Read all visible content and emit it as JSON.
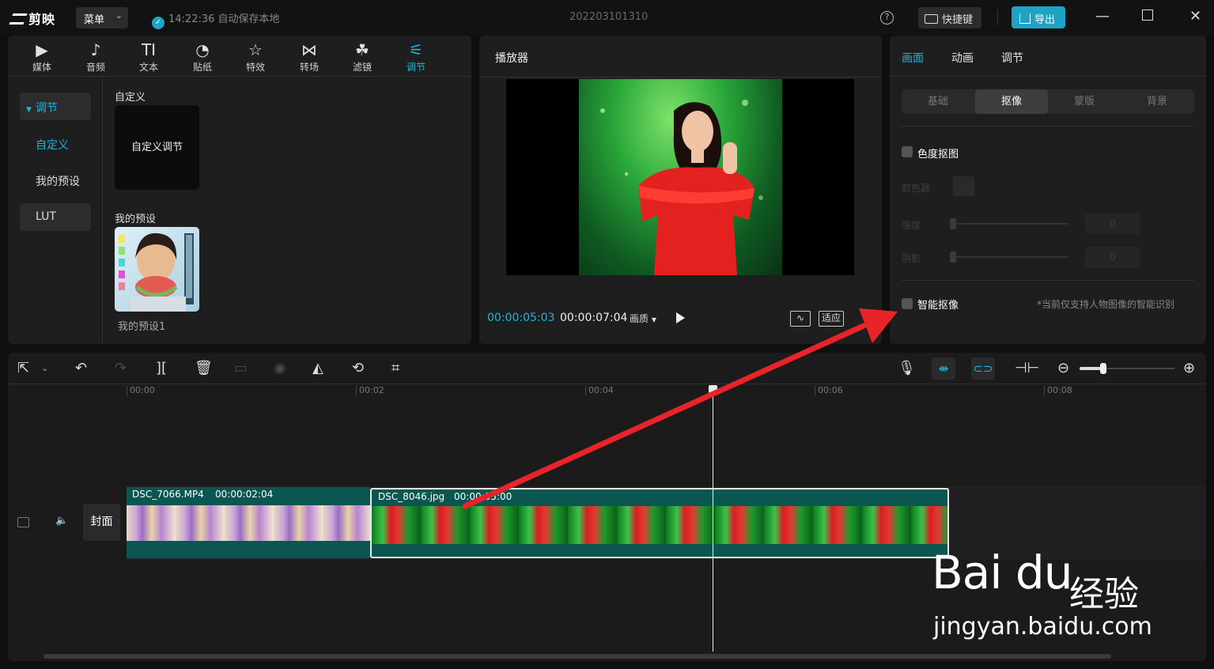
{
  "app": {
    "logo": "剪映",
    "menu": "菜单",
    "save_status": "14:22:36 自动保存本地",
    "project_title": "202203101310",
    "help": "?",
    "shortcut": "快捷键",
    "export": "导出"
  },
  "left_panel": {
    "tools": [
      {
        "label": "媒体",
        "icon": "media-icon"
      },
      {
        "label": "音频",
        "icon": "audio-icon"
      },
      {
        "label": "文本",
        "icon": "text-icon",
        "glyph": "TI"
      },
      {
        "label": "贴纸",
        "icon": "sticker-icon"
      },
      {
        "label": "特效",
        "icon": "effects-icon"
      },
      {
        "label": "转场",
        "icon": "transition-icon"
      },
      {
        "label": "滤镜",
        "icon": "filter-icon"
      },
      {
        "label": "调节",
        "icon": "adjust-icon"
      }
    ],
    "active_tool": "调节",
    "side": {
      "header": "调节",
      "items": [
        "自定义",
        "我的预设",
        "LUT"
      ]
    },
    "custom_section": "自定义",
    "custom_card": "自定义调节",
    "preset_section": "我的预设",
    "preset_name": "我的预设1"
  },
  "player": {
    "title": "播放器",
    "current_time": "00:00:05:03",
    "total_time": "00:00:07:04",
    "quality": "画质",
    "fit": "适应"
  },
  "right_panel": {
    "tabs": [
      "画面",
      "动画",
      "调节"
    ],
    "active_tab": "画面",
    "segments": [
      "基础",
      "抠像",
      "蒙版",
      "背景"
    ],
    "active_segment": "抠像",
    "chroma_key": {
      "label": "色度抠图",
      "picker": "取色器",
      "intensity": "强度",
      "shadow": "阴影",
      "intensity_value": "0",
      "shadow_value": "0"
    },
    "smart_cutout": {
      "label": "智能抠像",
      "hint": "*当前仅支持人物图像的智能识别"
    }
  },
  "timeline": {
    "ruler": [
      "00:00",
      "00:02",
      "00:04",
      "00:06",
      "00:08"
    ],
    "cover": "封面",
    "clips": [
      {
        "name": "DSC_7066.MP4",
        "duration": "00:00:02:04"
      },
      {
        "name": "DSC_8046.jpg",
        "duration": "00:00:05:00"
      }
    ],
    "zoom_level": 0.25
  },
  "watermark": {
    "brand": "Bai du",
    "cn": "经验",
    "url": "jingyan.baidu.com"
  },
  "colors": {
    "accent": "#1fb4d8",
    "arrow": "#e8232a",
    "clip_teal": "#0b5651"
  }
}
